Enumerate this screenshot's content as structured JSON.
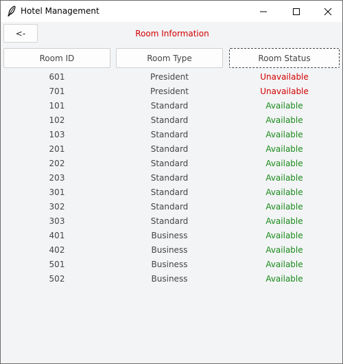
{
  "window": {
    "title": "Hotel Management"
  },
  "toolbar": {
    "back_label": "<-",
    "heading": "Room Information"
  },
  "table": {
    "headers": [
      "Room ID",
      "Room Type",
      "Room Status"
    ],
    "rows": [
      {
        "id": "601",
        "type": "President",
        "status": "Unavailable"
      },
      {
        "id": "701",
        "type": "President",
        "status": "Unavailable"
      },
      {
        "id": "101",
        "type": "Standard",
        "status": "Available"
      },
      {
        "id": "102",
        "type": "Standard",
        "status": "Available"
      },
      {
        "id": "103",
        "type": "Standard",
        "status": "Available"
      },
      {
        "id": "201",
        "type": "Standard",
        "status": "Available"
      },
      {
        "id": "202",
        "type": "Standard",
        "status": "Available"
      },
      {
        "id": "203",
        "type": "Standard",
        "status": "Available"
      },
      {
        "id": "301",
        "type": "Standard",
        "status": "Available"
      },
      {
        "id": "302",
        "type": "Standard",
        "status": "Available"
      },
      {
        "id": "303",
        "type": "Standard",
        "status": "Available"
      },
      {
        "id": "401",
        "type": "Business",
        "status": "Available"
      },
      {
        "id": "402",
        "type": "Business",
        "status": "Available"
      },
      {
        "id": "501",
        "type": "Business",
        "status": "Available"
      },
      {
        "id": "502",
        "type": "Business",
        "status": "Available"
      }
    ]
  },
  "colors": {
    "heading": "#d10000",
    "available": "#1a8a1a",
    "unavailable": "#d10000"
  }
}
